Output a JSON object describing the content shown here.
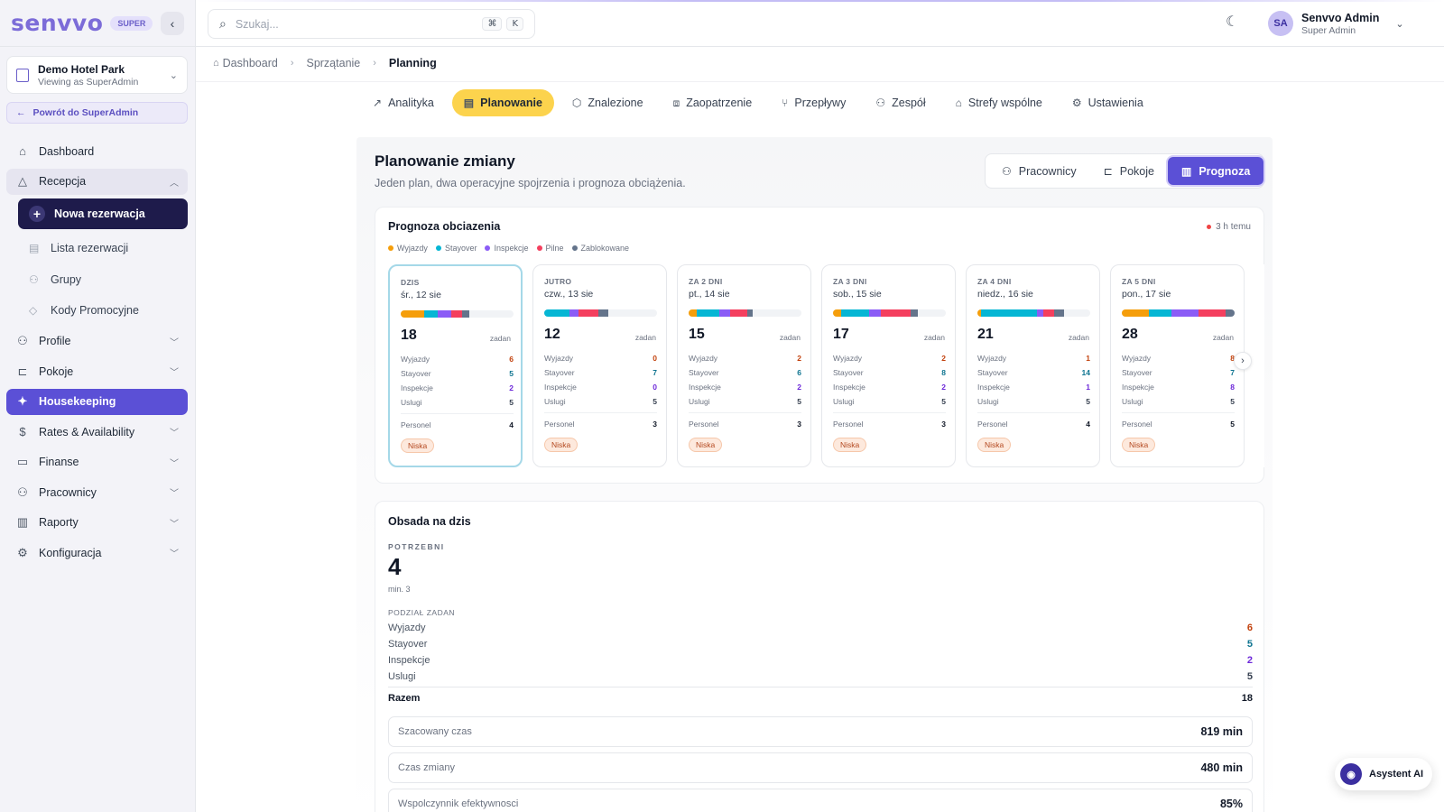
{
  "brand": {
    "logo": "senvvo",
    "badge": "SUPER"
  },
  "hotel": {
    "name": "Demo Hotel Park",
    "sub": "Viewing as SuperAdmin"
  },
  "back_button": "Powrót do SuperAdmin",
  "sidebar": {
    "dashboard": "Dashboard",
    "recepcja": "Recepcja",
    "nowa_rezerwacja": "Nowa rezerwacja",
    "lista_rezerwacji": "Lista rezerwacji",
    "grupy": "Grupy",
    "kody": "Kody Promocyjne",
    "profile": "Profile",
    "pokoje": "Pokoje",
    "housekeeping": "Housekeeping",
    "rates": "Rates & Availability",
    "finanse": "Finanse",
    "pracownicy": "Pracownicy",
    "raporty": "Raporty",
    "konfiguracja": "Konfiguracja"
  },
  "search": {
    "placeholder": "Szukaj...",
    "shortcut_mod": "⌘",
    "shortcut_key": "K"
  },
  "user": {
    "initials": "SA",
    "name": "Senvvo Admin",
    "role": "Super Admin"
  },
  "breadcrumb": [
    "Dashboard",
    "Sprzątanie",
    "Planning"
  ],
  "tabs": [
    "Analityka",
    "Planowanie",
    "Znalezione",
    "Zaopatrzenie",
    "Przepływy",
    "Zespół",
    "Strefy wspólne",
    "Ustawienia"
  ],
  "page": {
    "title": "Planowanie zmiany",
    "subtitle": "Jeden plan, dwa operacyjne spojrzenia i prognoza obciążenia."
  },
  "view_switch": [
    "Pracownicy",
    "Pokoje",
    "Prognoza"
  ],
  "forecast": {
    "title": "Prognoza obciazenia",
    "updated": "3 h temu",
    "legend": [
      {
        "name": "Wyjazdy",
        "color": "#f59e0b"
      },
      {
        "name": "Stayover",
        "color": "#06b6d4"
      },
      {
        "name": "Inspekcje",
        "color": "#8b5cf6"
      },
      {
        "name": "Pilne",
        "color": "#f43f5e"
      },
      {
        "name": "Zablokowane",
        "color": "#64748b"
      }
    ],
    "row_labels": [
      "Wyjazdy",
      "Stayover",
      "Inspekcje",
      "Uslugi"
    ],
    "zadan": "zadan",
    "personel_label": "Personel",
    "days": [
      {
        "label": "DZIS",
        "date": "śr., 12 sie",
        "total": "18",
        "wyjazdy": "6",
        "stayover": "5",
        "inspekcje": "2",
        "uslugi": "5",
        "personel": "4",
        "level": "Niska",
        "bar": [
          21,
          12,
          12,
          9,
          7
        ]
      },
      {
        "label": "JUTRO",
        "date": "czw., 13 sie",
        "total": "12",
        "wyjazdy": "0",
        "stayover": "7",
        "inspekcje": "0",
        "uslugi": "5",
        "personel": "3",
        "level": "Niska",
        "bar": [
          0,
          22,
          8,
          18,
          9
        ]
      },
      {
        "label": "ZA 2 DNI",
        "date": "pt., 14 sie",
        "total": "15",
        "wyjazdy": "2",
        "stayover": "6",
        "inspekcje": "2",
        "uslugi": "5",
        "personel": "3",
        "level": "Niska",
        "bar": [
          7,
          20,
          10,
          15,
          5
        ]
      },
      {
        "label": "ZA 3 DNI",
        "date": "sob., 15 sie",
        "total": "17",
        "wyjazdy": "2",
        "stayover": "8",
        "inspekcje": "2",
        "uslugi": "5",
        "personel": "3",
        "level": "Niska",
        "bar": [
          7,
          25,
          10,
          27,
          6
        ]
      },
      {
        "label": "ZA 4 DNI",
        "date": "niedz., 16 sie",
        "total": "21",
        "wyjazdy": "1",
        "stayover": "14",
        "inspekcje": "1",
        "uslugi": "5",
        "personel": "4",
        "level": "Niska",
        "bar": [
          3,
          50,
          5,
          10,
          9
        ]
      },
      {
        "label": "ZA 5 DNI",
        "date": "pon., 17 sie",
        "total": "28",
        "wyjazdy": "8",
        "stayover": "7",
        "inspekcje": "8",
        "uslugi": "5",
        "personel": "5",
        "level": "Niska",
        "bar": [
          24,
          20,
          24,
          24,
          8
        ]
      }
    ]
  },
  "staffing": {
    "title": "Obsada na dzis",
    "needed_label": "POTRZEBNI",
    "needed_value": "4",
    "needed_min": "min. 3",
    "split_label": "PODZIAŁ ZADAN",
    "rows": [
      {
        "label": "Wyjazdy",
        "value": "6",
        "color": "#c2410c"
      },
      {
        "label": "Stayover",
        "value": "5",
        "color": "#0e7490"
      },
      {
        "label": "Inspekcje",
        "value": "2",
        "color": "#6d28d9"
      },
      {
        "label": "Uslugi",
        "value": "5",
        "color": "#374151"
      }
    ],
    "total_label": "Razem",
    "total_value": "18",
    "stats": [
      {
        "label": "Szacowany czas",
        "value": "819 min"
      },
      {
        "label": "Czas zmiany",
        "value": "480 min"
      },
      {
        "label": "Wspolczynnik efektywnosci",
        "value": "85%"
      }
    ]
  },
  "ai_button": "Asystent AI"
}
